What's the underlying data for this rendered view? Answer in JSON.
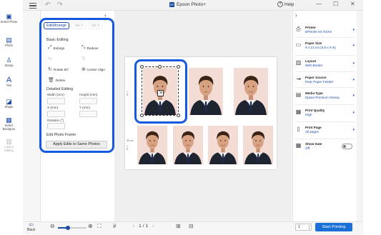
{
  "app": {
    "title": "Epson Photo+",
    "logo_text": "EP",
    "help_label": "Help"
  },
  "titlebar": {
    "menu_icon": "hamburger-icon",
    "undo_icon": "undo-icon",
    "redo_icon": "redo-icon"
  },
  "rail": {
    "items": [
      {
        "label": "Select Photo",
        "icon": "image-icon"
      },
      {
        "label": "Photo",
        "icon": "photo-icon"
      },
      {
        "label": "Stamp",
        "icon": "stamp-icon"
      },
      {
        "label": "Text",
        "icon": "text-icon"
      },
      {
        "label": "Shape",
        "icon": "shape-icon"
      },
      {
        "label": "Select Backgrou",
        "icon": "background-icon"
      },
      {
        "label": "Layout Editing",
        "icon": "layout-icon"
      }
    ]
  },
  "edit_panel": {
    "tabs": [
      {
        "label": "Edit/Arrange"
      },
      {
        "label": "Tab 2"
      },
      {
        "label": "Tab 3"
      }
    ],
    "basic_editing": {
      "heading": "Basic Editing",
      "enlarge": "Enlarge",
      "reduce": "Reduce",
      "rotate": "Rotate 90°",
      "center_align": "Center Align",
      "delete": "Delete"
    },
    "detailed_editing": {
      "heading": "Detailed Editing",
      "width": "Width (mm)",
      "height": "Height (mm)",
      "x": "X (mm)",
      "y": "Y (mm)",
      "rotation": "Rotation (°)"
    },
    "photo_frame": {
      "heading": "Edit Photo Frame"
    },
    "apply_button": "Apply Edits to Same Photos"
  },
  "canvas": {
    "ruler_labels": {
      "top": "◯",
      "left_top": "1\nR",
      "left_bottom": "30 cm\n\n\n1\nR"
    }
  },
  "settings": {
    "items": [
      {
        "label": "Printer",
        "value": "EPSON XX-XXXX",
        "icon": "printer-icon"
      },
      {
        "label": "Paper Size",
        "value": "9 x 13 cm (3.5 x 5 in)",
        "icon": "paper-size-icon"
      },
      {
        "label": "Layout",
        "value": "With Border",
        "icon": "layout-icon"
      },
      {
        "label": "Paper Source",
        "value": "Rear Paper Feeder",
        "icon": "paper-source-icon"
      },
      {
        "label": "Media Type",
        "value": "Epson Premium Glossy",
        "icon": "media-type-icon"
      },
      {
        "label": "Print Quality",
        "value": "High",
        "icon": "print-quality-icon"
      },
      {
        "label": "Print Page",
        "value": "All pages",
        "icon": "print-page-icon"
      },
      {
        "label": "Show Date",
        "value": "Off",
        "icon": "calendar-icon"
      }
    ]
  },
  "bottom": {
    "back_label": "Back",
    "page_current": "1",
    "page_sep": "/",
    "page_total": "1",
    "copies": "1",
    "print_button": "Start Printing",
    "zoom_level": 0.35
  },
  "colors": {
    "accent": "#1b4aa8",
    "callout": "#1659e0",
    "print_button": "#1b6fd8",
    "photo_bg": "#f3dcd3"
  }
}
